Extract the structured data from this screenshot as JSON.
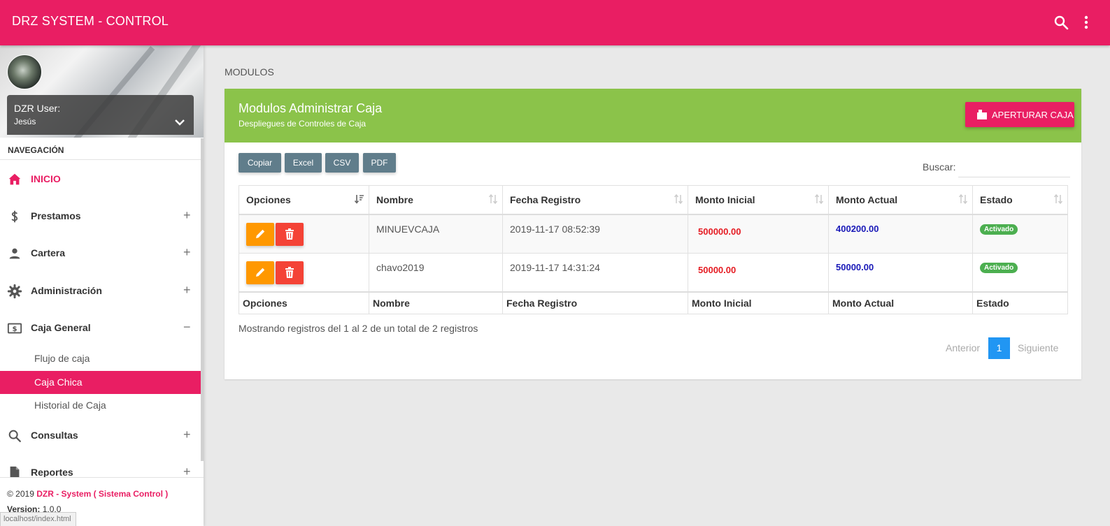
{
  "app": {
    "title": "DRZ SYSTEM - CONTROL"
  },
  "user": {
    "label": "DZR User:",
    "name": "Jesús"
  },
  "sidebar": {
    "header": "NAVEGACIÓN",
    "items": [
      {
        "label": "INICIO",
        "toggle": ""
      },
      {
        "label": "Prestamos",
        "toggle": "+"
      },
      {
        "label": "Cartera",
        "toggle": "+"
      },
      {
        "label": "Administración",
        "toggle": "+"
      },
      {
        "label": "Caja General",
        "toggle": "−"
      },
      {
        "label": "Consultas",
        "toggle": "+"
      },
      {
        "label": "Reportes",
        "toggle": "+"
      }
    ],
    "subitems": [
      {
        "label": "Flujo de caja"
      },
      {
        "label": "Caja Chica"
      },
      {
        "label": "Historial de Caja"
      }
    ],
    "footer": {
      "copyright": "© 2019",
      "brand": "DZR - System ( Sistema Control )",
      "version_label": "Version:",
      "version_value": "1.0.0"
    },
    "status_url": "localhost/index.html"
  },
  "main": {
    "heading": "MODULOS",
    "card": {
      "title": "Modulos Administrar Caja",
      "subtitle": "Despliegues de Controles de Caja",
      "action_label": "APERTURAR CAJA"
    },
    "export_buttons": [
      "Copiar",
      "Excel",
      "CSV",
      "PDF"
    ],
    "search": {
      "label": "Buscar:",
      "value": ""
    },
    "table": {
      "columns": [
        "Opciones",
        "Nombre",
        "Fecha Registro",
        "Monto Inicial",
        "Monto Actual",
        "Estado"
      ],
      "rows": [
        {
          "nombre": "MINUEVCAJA",
          "fecha": "2019-11-17 08:52:39",
          "monto_inicial": "500000.00",
          "monto_actual": "400200.00",
          "estado": "Activado"
        },
        {
          "nombre": "chavo2019",
          "fecha": "2019-11-17 14:31:24",
          "monto_inicial": "50000.00",
          "monto_actual": "50000.00",
          "estado": "Activado"
        }
      ]
    },
    "info": "Mostrando registros del 1 al 2 de un total de 2 registros",
    "pagination": {
      "previous": "Anterior",
      "current": "1",
      "next": "Siguiente"
    }
  },
  "colors": {
    "primary": "#e91e63",
    "header_green": "#8bc34a",
    "export_gray": "#607d8b",
    "edit_orange": "#ff9800",
    "delete_red": "#f44336",
    "badge_green": "#4caf50",
    "page_blue": "#2196f3"
  },
  "icons": {
    "top": [
      "search-icon",
      "more-vert-icon"
    ],
    "nav": [
      "home-icon",
      "dollar-icon",
      "person-icon",
      "gear-icon",
      "cash-icon",
      "search-icon",
      "document-icon"
    ]
  }
}
